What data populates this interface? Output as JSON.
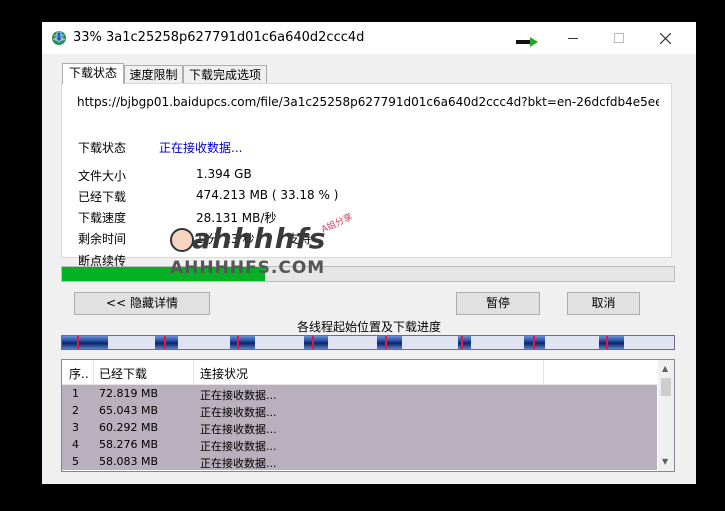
{
  "window": {
    "title": "33% 3a1c25258p627791d01c6a640d2ccc4d"
  },
  "tabs": [
    "下载状态",
    "速度限制",
    "下载完成选项"
  ],
  "status_panel": {
    "url": "https://bjbgp01.baidupcs.com/file/3a1c25258p627791d01c6a640d2ccc4d?bkt=en-26dcfdb4e5ee1a4978",
    "status_label": "下载状态",
    "status_value": "正在接收数据...",
    "file_size_label": "文件大小",
    "file_size_value": "1.394  GB",
    "downloaded_label": "已经下载",
    "downloaded_value": "474.213  MB  ( 33.18 % )",
    "speed_label": "下载速度",
    "speed_value": "28.131  MB/秒",
    "remaining_label": "剩余时间",
    "remaining_value": "1 分 13 秒",
    "resume_label": "断点续传",
    "resume_value": "支持"
  },
  "progress": {
    "percent": 33.18
  },
  "buttons": {
    "hide_details": "<< 隐藏详情",
    "pause": "暂停",
    "cancel": "取消"
  },
  "threads_title": "各线程起始位置及下载进度",
  "thread_segments": [
    {
      "start": 0.0,
      "end": 0.075
    },
    {
      "start": 0.152,
      "end": 0.19
    },
    {
      "start": 0.275,
      "end": 0.315
    },
    {
      "start": 0.395,
      "end": 0.435
    },
    {
      "start": 0.515,
      "end": 0.555
    },
    {
      "start": 0.647,
      "end": 0.668
    },
    {
      "start": 0.755,
      "end": 0.79
    },
    {
      "start": 0.878,
      "end": 0.918
    }
  ],
  "thread_markers": [
    0.025,
    0.167,
    0.286,
    0.409,
    0.527,
    0.652,
    0.769,
    0.889
  ],
  "thread_list": {
    "headers": [
      "序..",
      "已经下载",
      "连接状况"
    ],
    "rows": [
      {
        "no": "1",
        "downloaded": "72.819  MB",
        "status": "正在接收数据..."
      },
      {
        "no": "2",
        "downloaded": "65.043  MB",
        "status": "正在接收数据..."
      },
      {
        "no": "3",
        "downloaded": "60.292  MB",
        "status": "正在接收数据..."
      },
      {
        "no": "4",
        "downloaded": "58.276  MB",
        "status": "正在接收数据..."
      },
      {
        "no": "5",
        "downloaded": "58.083  MB",
        "status": "正在接收数据..."
      }
    ]
  },
  "watermark": {
    "text": "ahhhhfs",
    "tag": "A姐分享",
    "domain": "AHHHHFS.COM"
  },
  "colors": {
    "progress_fill": "#06b025",
    "status_link": "#0000cc",
    "row_highlight": "#b9b0bd"
  }
}
